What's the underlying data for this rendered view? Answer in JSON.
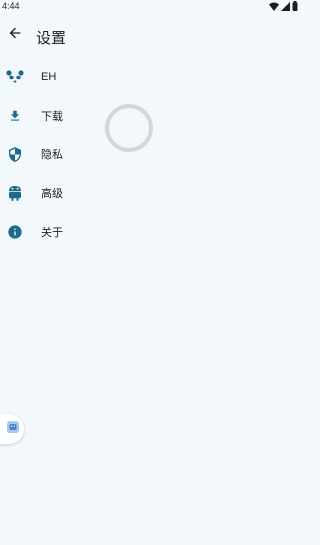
{
  "status_bar": {
    "time": "4:44",
    "icons": [
      "wifi-icon",
      "signal-icon",
      "battery-icon"
    ]
  },
  "header": {
    "title": "设置",
    "back_icon": "arrow-left-icon"
  },
  "menu": {
    "items": [
      {
        "label": "EH",
        "icon": "panda-icon"
      },
      {
        "label": "下载",
        "icon": "download-icon"
      },
      {
        "label": "隐私",
        "icon": "shield-icon"
      },
      {
        "label": "高级",
        "icon": "android-icon"
      },
      {
        "label": "关于",
        "icon": "info-icon"
      }
    ]
  },
  "colors": {
    "background": "#f3f8fc",
    "icon": "#1c6b8a",
    "spinner": "#d3d7db"
  },
  "floating_button": {
    "icon": "assistant-icon"
  }
}
